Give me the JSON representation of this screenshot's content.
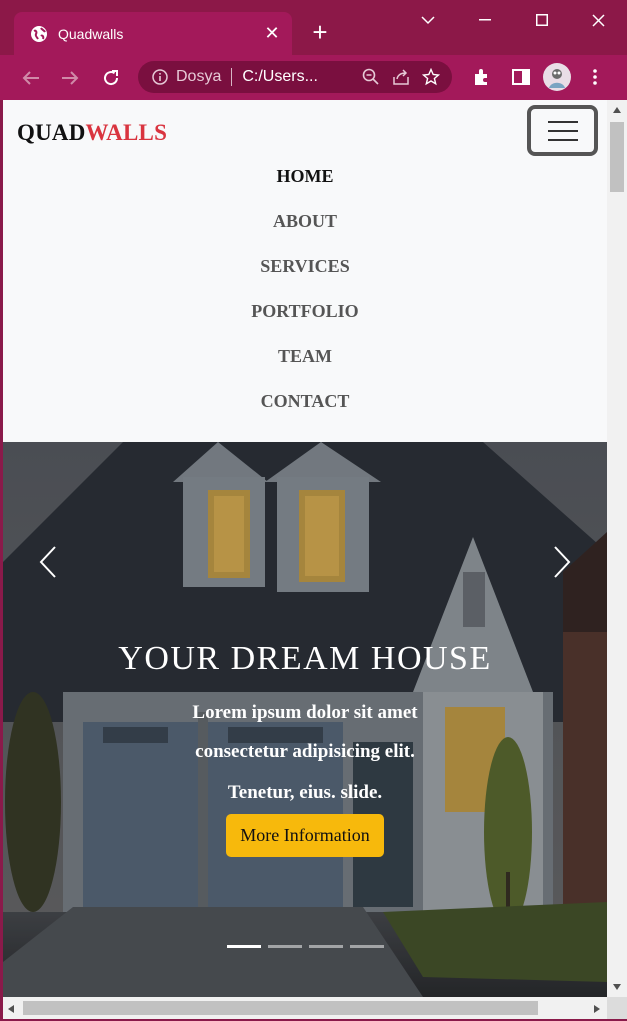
{
  "browser": {
    "tab_title": "Quadwalls",
    "tab_close": "✕",
    "new_tab": "+",
    "site_label": "Dosya",
    "url_path": "C:/Users..."
  },
  "site": {
    "brand_part1": "QUAD",
    "brand_part2": "WALLS",
    "menu": [
      "HOME",
      "ABOUT",
      "SERVICES",
      "PORTFOLIO",
      "TEAM",
      "CONTACT"
    ]
  },
  "hero": {
    "title": "YOUR DREAM HOUSE",
    "line1": "Lorem ipsum dolor sit amet",
    "line2": "consectetur adipisicing elit.",
    "line3": "Tenetur, eius. slide.",
    "cta": "More Information",
    "active_slide": 1,
    "slide_count": 4
  },
  "colors": {
    "browser_frame": "#8c1848",
    "brand_accent": "#d9343f",
    "cta_bg": "#f7b90c"
  }
}
